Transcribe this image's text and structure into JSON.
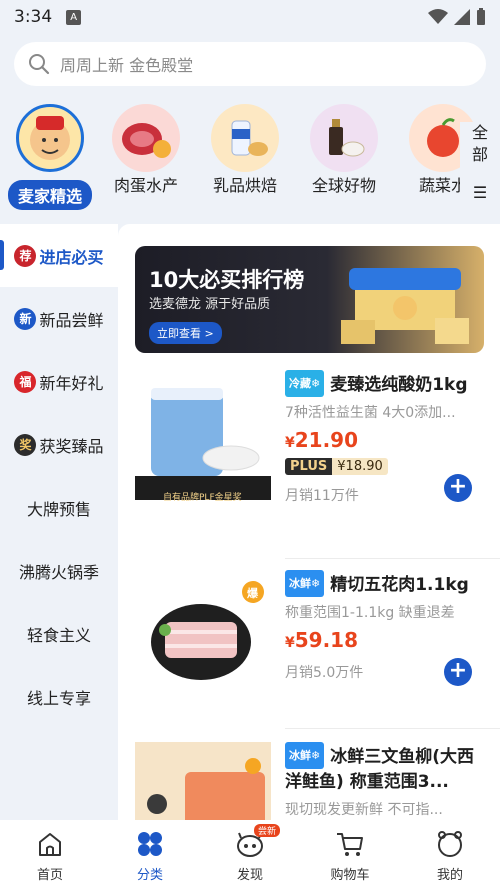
{
  "status": {
    "time": "3:34",
    "notif": "A"
  },
  "search": {
    "placeholder": "周周上新 金色殿堂"
  },
  "categories": [
    {
      "label": "麦家精选",
      "active": true
    },
    {
      "label": "肉蛋水产"
    },
    {
      "label": "乳品烘焙"
    },
    {
      "label": "全球好物"
    },
    {
      "label": "蔬菜水"
    }
  ],
  "more": {
    "l1": "全",
    "l2": "部",
    "l3": "☰"
  },
  "side": [
    {
      "label": "进店必买",
      "badge": "荐",
      "active": true
    },
    {
      "label": "新品尝鲜",
      "badge": "新"
    },
    {
      "label": "新年好礼",
      "badge": "福"
    },
    {
      "label": "获奖臻品",
      "badge": "奖"
    },
    {
      "label": "大牌预售"
    },
    {
      "label": "沸腾火锅季"
    },
    {
      "label": "轻食主义"
    },
    {
      "label": "线上专享"
    }
  ],
  "banner": {
    "title": "10大必买排行榜",
    "subtitle": "选麦德龙 源于好品质",
    "button": "立即查看 >"
  },
  "products": [
    {
      "tag": "冷藏❄",
      "name": "麦臻选纯酸奶1kg",
      "desc": "7种活性益生菌 4大0添加...",
      "yen": "¥",
      "price": "21.90",
      "plus_label": "PLUS",
      "plus_price": "¥18.90",
      "sales": "月销11万件",
      "award": "自有品牌PLF金星奖"
    },
    {
      "tag": "冰鲜❄",
      "name": "精切五花肉1.1kg",
      "desc": "称重范围1-1.1kg 缺重退差",
      "yen": "¥",
      "price": "59.18",
      "sales": "月销5.0万件",
      "hot": "爆"
    },
    {
      "tag": "冰鲜❄",
      "name": "冰鲜三文鱼柳(大西洋鲑鱼) 称重范围3...",
      "desc": "现切现发更新鲜 不可指..."
    }
  ],
  "tabs": [
    {
      "label": "首页"
    },
    {
      "label": "分类",
      "active": true
    },
    {
      "label": "发现",
      "badge": "尝新"
    },
    {
      "label": "购物车"
    },
    {
      "label": "我的"
    }
  ]
}
